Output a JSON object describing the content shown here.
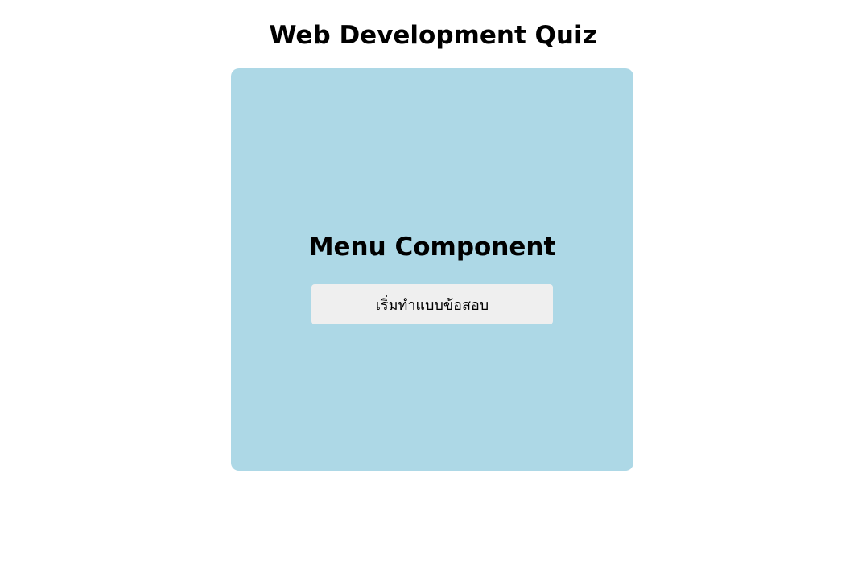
{
  "page": {
    "title": "Web Development Quiz"
  },
  "menu": {
    "title": "Menu Component",
    "start_button_label": "เริ่มทำแบบข้อสอบ"
  },
  "colors": {
    "card_background": "#add8e6",
    "button_background": "#efefef",
    "page_background": "#ffffff"
  }
}
